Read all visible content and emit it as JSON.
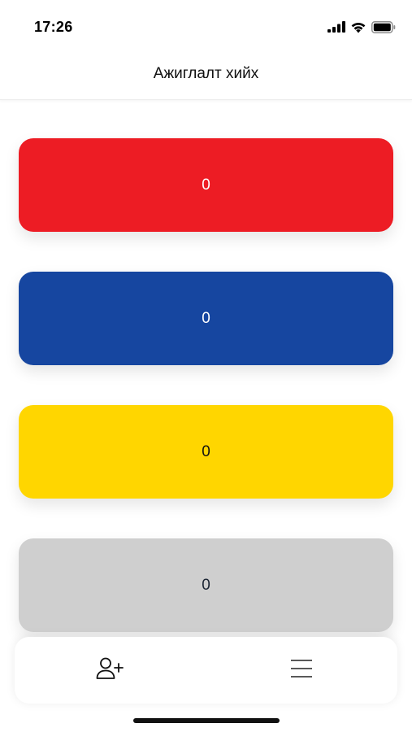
{
  "status_bar": {
    "time": "17:26",
    "icons": [
      "cellular-signal-icon",
      "wifi-icon",
      "battery-icon"
    ]
  },
  "header": {
    "title": "Ажиглалт хийх"
  },
  "cards": [
    {
      "id": "red",
      "value": "0",
      "color": "#ED1C24",
      "text_color": "#ffffff"
    },
    {
      "id": "blue",
      "value": "0",
      "color": "#1646A0",
      "text_color": "#ffffff"
    },
    {
      "id": "yellow",
      "value": "0",
      "color": "#FFD600",
      "text_color": "#111111"
    },
    {
      "id": "gray",
      "value": "0",
      "color": "#CFCFCF",
      "text_color": "#1a2433"
    }
  ],
  "bottom_nav": {
    "items": [
      {
        "icon": "add-user-icon"
      },
      {
        "icon": "menu-icon"
      }
    ]
  }
}
